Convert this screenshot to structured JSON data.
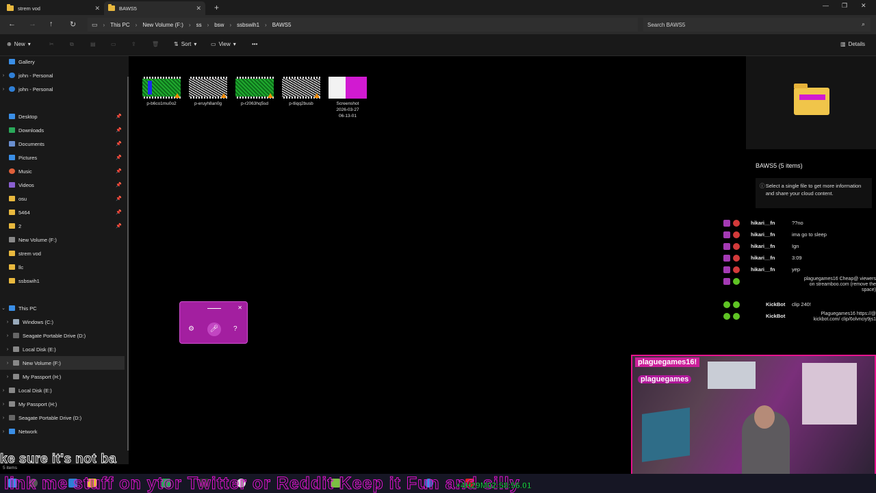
{
  "tabs": [
    {
      "label": "strem vod"
    },
    {
      "label": "BAWS5"
    }
  ],
  "address": {
    "crumbs": [
      "This PC",
      "New Volume (F:)",
      "ss",
      "bsw",
      "ssbswih1",
      "BAWS5"
    ],
    "search_placeholder": "Search BAWS5"
  },
  "toolbar": {
    "new_label": "New",
    "sort_label": "Sort",
    "view_label": "View",
    "details_label": "Details"
  },
  "sidebar": {
    "items": [
      {
        "label": "Gallery"
      },
      {
        "label": "john - Personal"
      },
      {
        "label": "john - Personal"
      },
      {
        "label": "Desktop"
      },
      {
        "label": "Downloads"
      },
      {
        "label": "Documents"
      },
      {
        "label": "Pictures"
      },
      {
        "label": "Music"
      },
      {
        "label": "Videos"
      },
      {
        "label": "osu"
      },
      {
        "label": "5464"
      },
      {
        "label": "2"
      },
      {
        "label": "New Volume (F:)"
      },
      {
        "label": "strem vod"
      },
      {
        "label": "llc"
      },
      {
        "label": "ssbswih1"
      },
      {
        "label": "This PC"
      },
      {
        "label": "Windows (C:)"
      },
      {
        "label": "Seagate Portable Drive (D:)"
      },
      {
        "label": "Local Disk (E:)"
      },
      {
        "label": "New Volume (F:)"
      },
      {
        "label": "My Passport (H:)"
      },
      {
        "label": "Local Disk (E:)"
      },
      {
        "label": "My Passport (H:)"
      },
      {
        "label": "Seagate Portable Drive (D:)"
      },
      {
        "label": "Network"
      }
    ]
  },
  "files": [
    {
      "name": "p-b6co1mu0o2",
      "kind": "green"
    },
    {
      "name": "p-eruyh8an0g",
      "kind": "noise"
    },
    {
      "name": "p-r2063hq5sd",
      "kind": "green"
    },
    {
      "name": "p-tliqq2busb",
      "kind": "noise"
    },
    {
      "name_lines": [
        "Screenshot",
        "2026-03-27",
        "06-13-01"
      ],
      "kind": "shot"
    }
  ],
  "details": {
    "title": "BAWS5 (5 items)",
    "info": "Select a single file to get more information and share your cloud content."
  },
  "chat": [
    {
      "user": "hikari__fn",
      "text": "??no"
    },
    {
      "user": "hikari__fn",
      "text": "ima go to sleep"
    },
    {
      "user": "hikari__fn",
      "text": "Ign"
    },
    {
      "user": "hikari__fn",
      "text": "3:09"
    },
    {
      "user": "hikari__fn",
      "text": "yep"
    },
    {
      "user": "",
      "text": "plaguegames16 Cheap@ viewers on streamboo.com (remove the space)"
    },
    {
      "user": "KickBot",
      "text": "clip 240!"
    },
    {
      "user": "KickBot",
      "text": "Plaguegames16 https://@ kickbot.com/ clip/6olvnciy9js1"
    }
  ],
  "webcam": {
    "handle_top": "plaguegames16!",
    "handle_bottom": "plaguegames"
  },
  "status_text": "5 items",
  "caption_text": "ke sure it's not ba",
  "ticker_text": "link me stuff on ytor Twitter or Reddit Keep it Fun and silly",
  "timer_text": "+4H29M02:58:56.01",
  "colors": {
    "folder": "#e8b83e",
    "chat_platform": "#a43ab4",
    "webcam_border": "#e6128d",
    "voice_widget": "#a31fa0",
    "timer": "#1bd84c"
  }
}
